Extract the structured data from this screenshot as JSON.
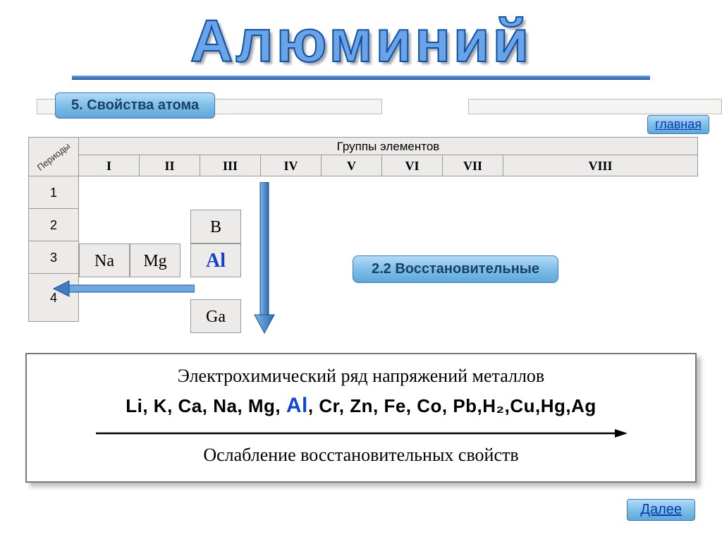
{
  "title": "Алюминий",
  "section_tab": "5. Свойства атома",
  "home_link": "главная",
  "periods_label": "Периоды",
  "groups_title": "Группы элементов",
  "roman": [
    "I",
    "II",
    "III",
    "IV",
    "V",
    "VI",
    "VII",
    "VIII"
  ],
  "periods": [
    "1",
    "2",
    "3",
    "4"
  ],
  "elements": {
    "Na": "Na",
    "Mg": "Mg",
    "B": "B",
    "Al": "Al",
    "Ga": "Ga"
  },
  "reducing_box": "2.2 Восстановительные",
  "activity": {
    "title": "Электрохимический ряд напряжений металлов",
    "series_before": "Li, K, Ca, Na, Mg, ",
    "series_al": "Al",
    "series_after": ", Cr, Zn, Fe, Co, Pb,H₂,Cu,Hg,Ag",
    "weakening": "Ослабление восстановительных свойств"
  },
  "next_link": "Далее"
}
